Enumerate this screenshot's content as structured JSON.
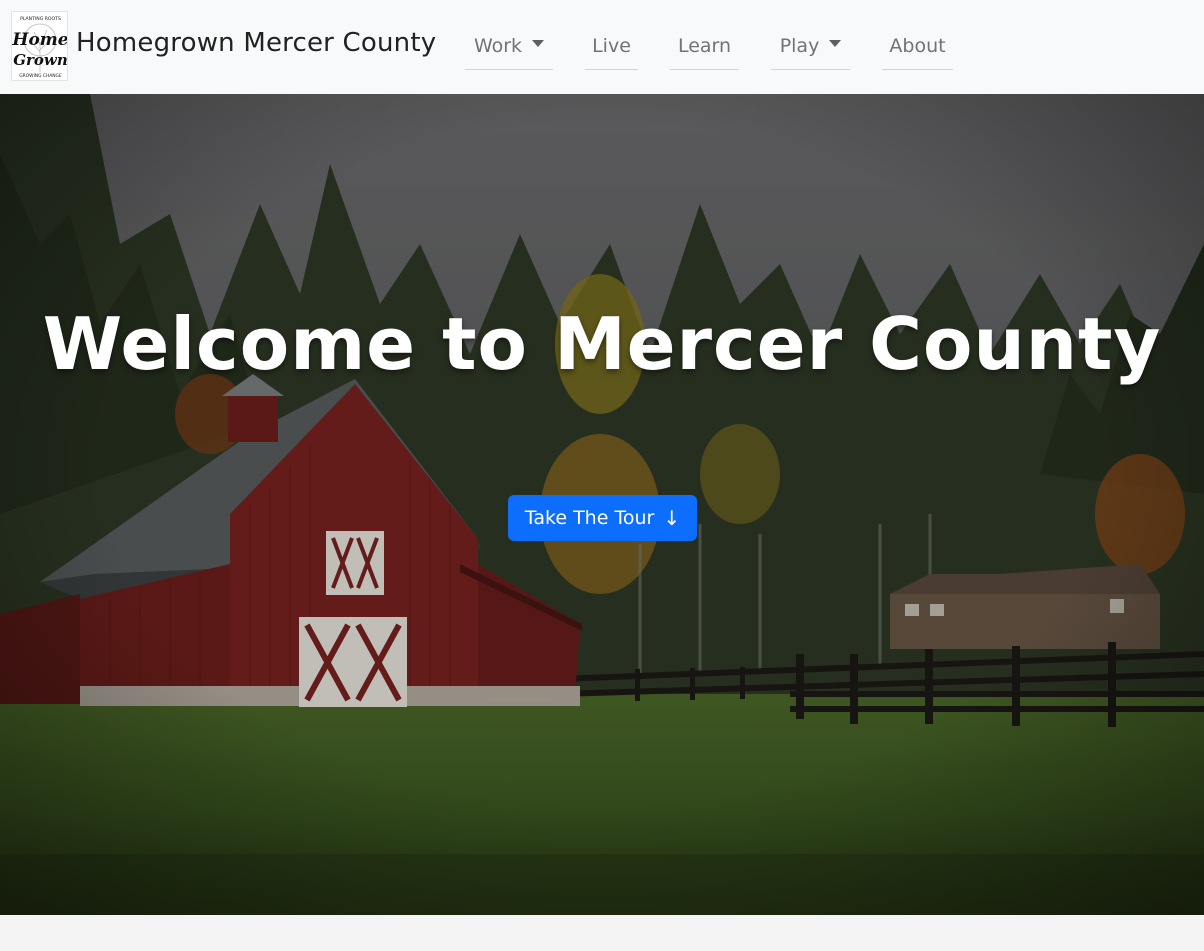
{
  "brand": {
    "name": "Homegrown Mercer County",
    "logo_text_top": "PLANTING ROOTS",
    "logo_text_main1": "Home",
    "logo_text_main2": "Grown",
    "logo_text_bottom": "GROWING CHANGE"
  },
  "nav": {
    "items": [
      {
        "label": "Work",
        "dropdown": true
      },
      {
        "label": "Live",
        "dropdown": false
      },
      {
        "label": "Learn",
        "dropdown": false
      },
      {
        "label": "Play",
        "dropdown": true
      },
      {
        "label": "About",
        "dropdown": false
      }
    ]
  },
  "hero": {
    "title": "Welcome to Mercer County",
    "button_label": "Take The Tour",
    "button_icon": "arrow-down-icon",
    "button_color": "#0d6efd"
  }
}
